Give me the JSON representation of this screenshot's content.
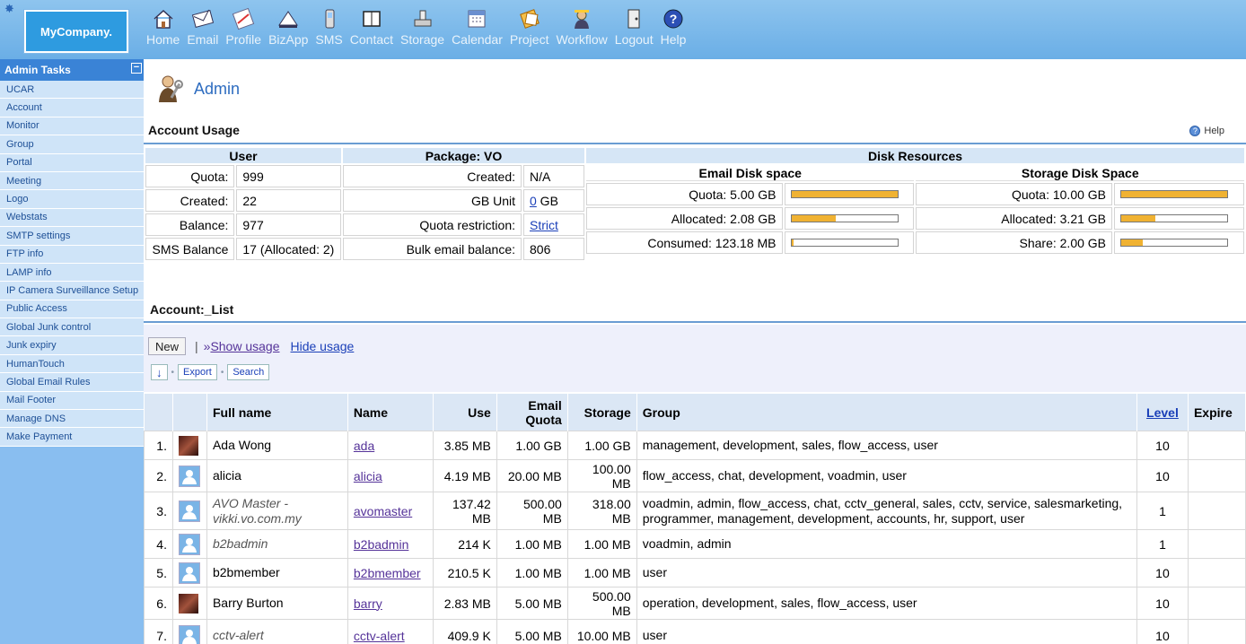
{
  "logo": "MyCompany.",
  "nav": [
    {
      "label": "Home",
      "icon": "home-icon"
    },
    {
      "label": "Email",
      "icon": "email-icon"
    },
    {
      "label": "Profile",
      "icon": "profile-icon"
    },
    {
      "label": "BizApp",
      "icon": "bizapp-icon"
    },
    {
      "label": "SMS",
      "icon": "sms-icon"
    },
    {
      "label": "Contact",
      "icon": "contact-icon"
    },
    {
      "label": "Storage",
      "icon": "storage-icon"
    },
    {
      "label": "Calendar",
      "icon": "calendar-icon"
    },
    {
      "label": "Project",
      "icon": "project-icon"
    },
    {
      "label": "Workflow",
      "icon": "workflow-icon"
    },
    {
      "label": "Logout",
      "icon": "logout-icon"
    },
    {
      "label": "Help",
      "icon": "help-icon"
    }
  ],
  "sidebar": {
    "title": "Admin Tasks",
    "items": [
      "UCAR",
      "Account",
      "Monitor",
      "Group",
      "Portal",
      "Meeting",
      "Logo",
      "Webstats",
      "SMTP settings",
      "FTP info",
      "LAMP info",
      "IP Camera Surveillance Setup",
      "Public Access",
      "Global Junk control",
      "Junk expiry",
      "HumanTouch",
      "Global Email Rules",
      "Mail Footer",
      "Manage DNS",
      "Make Payment"
    ]
  },
  "page": {
    "title": "Admin"
  },
  "usage": {
    "section_title": "Account Usage",
    "help": "Help",
    "user": {
      "header": "User",
      "rows": [
        {
          "label": "Quota:",
          "value": "999"
        },
        {
          "label": "Created:",
          "value": "22"
        },
        {
          "label": "Balance:",
          "value": "977"
        },
        {
          "label": "SMS Balance",
          "value": "17 (Allocated: 2)"
        }
      ]
    },
    "package": {
      "header": "Package: VO",
      "created_label": "Created:",
      "created_value": "N/A",
      "gb_label": "GB Unit",
      "gb_link": "0",
      "gb_suffix": " GB",
      "quota_label": "Quota restriction:",
      "quota_link": "Strict",
      "bulk_label": "Bulk email balance:",
      "bulk_value": "806"
    },
    "disk": {
      "header": "Disk Resources",
      "email_header": "Email Disk space",
      "storage_header": "Storage Disk Space",
      "email": [
        {
          "label": "Quota: 5.00 GB",
          "fill": 1.0
        },
        {
          "label": "Allocated: 2.08 GB",
          "fill": 0.416
        },
        {
          "label": "Consumed: 123.18 MB",
          "fill": 0.024
        }
      ],
      "storage": [
        {
          "label": "Quota: 10.00 GB",
          "fill": 1.0
        },
        {
          "label": "Allocated: 3.21 GB",
          "fill": 0.321
        },
        {
          "label": "Share: 2.00 GB",
          "fill": 0.2
        }
      ]
    }
  },
  "account_list": {
    "section_title": "Account:_List",
    "new_button": "New",
    "separator": "|",
    "show_prefix": "»",
    "show_usage": "Show usage",
    "hide_usage": "Hide usage",
    "down_arrow": "↓",
    "export": "Export",
    "search": "Search",
    "columns": [
      "Full name",
      "Name",
      "Use",
      "Email Quota",
      "Storage",
      "Group",
      "Level",
      "Expire"
    ],
    "rows": [
      {
        "n": "1.",
        "photo": true,
        "full": "Ada Wong",
        "italic": false,
        "name": "ada",
        "use": "3.85 MB",
        "quota": "1.00 GB",
        "storage": "1.00 GB",
        "group": "management, development, sales, flow_access, user",
        "level": "10"
      },
      {
        "n": "2.",
        "photo": false,
        "full": "alicia",
        "italic": false,
        "name": "alicia",
        "use": "4.19 MB",
        "quota": "20.00 MB",
        "storage": "100.00 MB",
        "group": "flow_access, chat, development, voadmin, user",
        "level": "10"
      },
      {
        "n": "3.",
        "photo": false,
        "full": "AVO Master - vikki.vo.com.my",
        "italic": true,
        "name": "avomaster",
        "use": "137.42 MB",
        "quota": "500.00 MB",
        "storage": "318.00 MB",
        "group": "voadmin, admin, flow_access, chat, cctv_general, sales, cctv, service, salesmarketing, programmer, management, development, accounts, hr, support, user",
        "level": "1"
      },
      {
        "n": "4.",
        "photo": false,
        "full": "b2badmin",
        "italic": true,
        "name": "b2badmin",
        "use": "214 K",
        "quota": "1.00 MB",
        "storage": "1.00 MB",
        "group": "voadmin, admin",
        "level": "1"
      },
      {
        "n": "5.",
        "photo": false,
        "full": "b2bmember",
        "italic": false,
        "name": "b2bmember",
        "use": "210.5 K",
        "quota": "1.00 MB",
        "storage": "1.00 MB",
        "group": "user",
        "level": "10"
      },
      {
        "n": "6.",
        "photo": true,
        "full": "Barry Burton",
        "italic": false,
        "name": "barry",
        "use": "2.83 MB",
        "quota": "5.00 MB",
        "storage": "500.00 MB",
        "group": "operation, development, sales, flow_access, user",
        "level": "10"
      },
      {
        "n": "7.",
        "photo": false,
        "full": "cctv-alert",
        "italic": true,
        "name": "cctv-alert",
        "use": "409.9 K",
        "quota": "5.00 MB",
        "storage": "10.00 MB",
        "group": "user",
        "level": "10"
      }
    ]
  }
}
